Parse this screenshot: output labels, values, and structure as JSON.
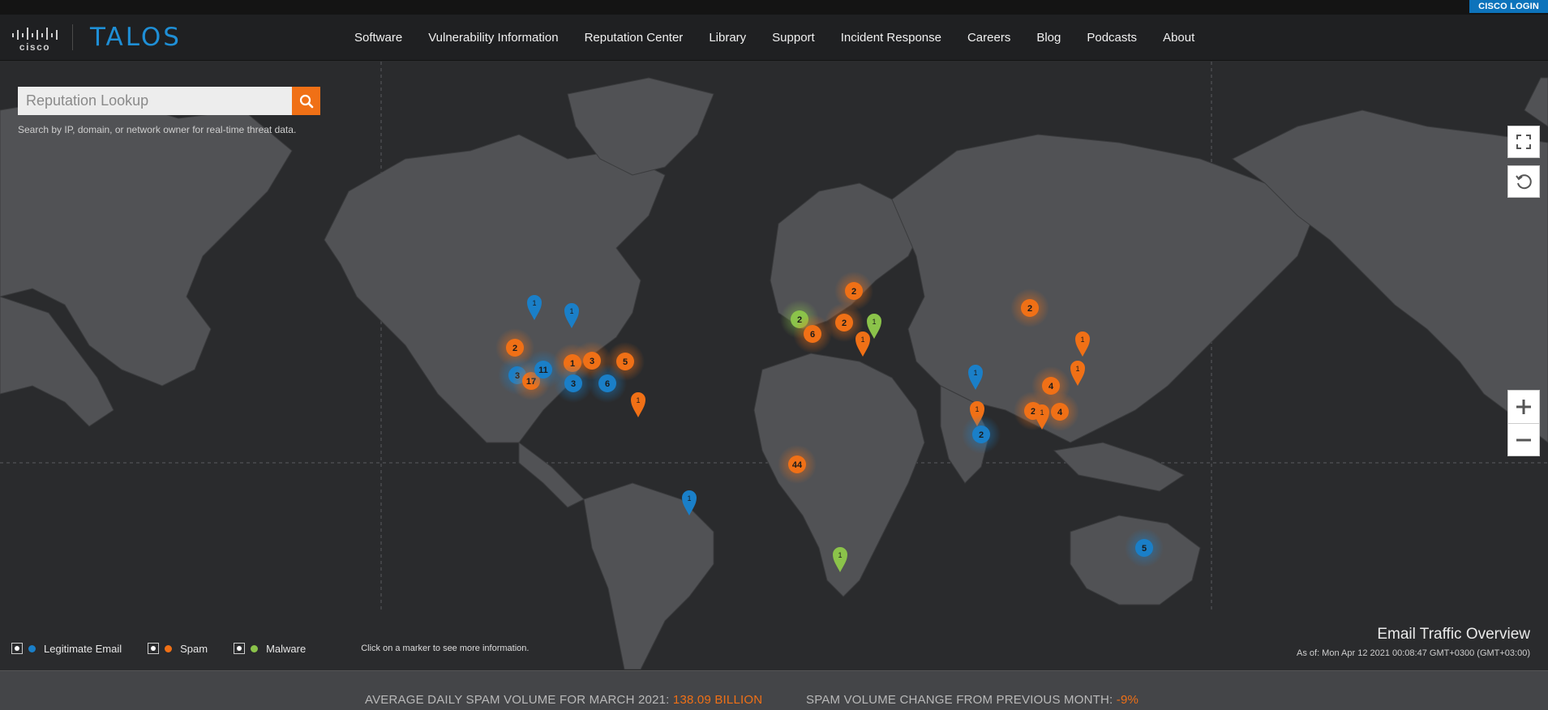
{
  "header": {
    "cisco_login": "CISCO LOGIN",
    "logo_cisco": "cisco",
    "logo_talos": "TALOS",
    "nav": [
      "Software",
      "Vulnerability Information",
      "Reputation Center",
      "Library",
      "Support",
      "Incident Response",
      "Careers",
      "Blog",
      "Podcasts",
      "About"
    ]
  },
  "search": {
    "placeholder": "Reputation Lookup",
    "help": "Search by IP, domain, or network owner for real-time threat data."
  },
  "legend": {
    "items": [
      {
        "label": "Legitimate Email",
        "color": "#1a7fc8"
      },
      {
        "label": "Spam",
        "color": "#f07016"
      },
      {
        "label": "Malware",
        "color": "#8bc34a"
      }
    ],
    "hint": "Click on a marker to see more information."
  },
  "overview": {
    "title": "Email Traffic Overview",
    "as_of": "As of: Mon Apr 12 2021 00:08:47 GMT+0300 (GMT+03:00)"
  },
  "stats": {
    "spam_volume_label": "AVERAGE DAILY SPAM VOLUME FOR MARCH 2021:",
    "spam_volume_value": "138.09 BILLION",
    "change_label": "SPAM VOLUME CHANGE FROM PREVIOUS MONTH:",
    "change_value": "-9%"
  },
  "colors": {
    "legit": "#1a7fc8",
    "spam": "#f07016",
    "malware": "#8bc34a"
  },
  "markers": [
    {
      "label": "1",
      "type": "legit",
      "kind": "pin"
    },
    {
      "label": "1",
      "type": "legit",
      "kind": "pin"
    },
    {
      "label": "2",
      "type": "spam",
      "kind": "cluster"
    },
    {
      "label": "3",
      "type": "legit",
      "kind": "cluster"
    },
    {
      "label": "17",
      "type": "spam",
      "kind": "cluster"
    },
    {
      "label": "11",
      "type": "legit",
      "kind": "cluster"
    },
    {
      "label": "1",
      "type": "spam",
      "kind": "cluster"
    },
    {
      "label": "3",
      "type": "spam",
      "kind": "cluster"
    },
    {
      "label": "5",
      "type": "spam",
      "kind": "cluster"
    },
    {
      "label": "3",
      "type": "legit",
      "kind": "cluster"
    },
    {
      "label": "6",
      "type": "legit",
      "kind": "cluster"
    },
    {
      "label": "1",
      "type": "spam",
      "kind": "pin"
    },
    {
      "label": "2",
      "type": "malware",
      "kind": "cluster"
    },
    {
      "label": "6",
      "type": "spam",
      "kind": "cluster"
    },
    {
      "label": "2",
      "type": "spam",
      "kind": "cluster"
    },
    {
      "label": "2",
      "type": "spam",
      "kind": "cluster"
    },
    {
      "label": "1",
      "type": "malware",
      "kind": "pin"
    },
    {
      "label": "1",
      "type": "spam",
      "kind": "pin"
    },
    {
      "label": "44",
      "type": "spam",
      "kind": "cluster"
    },
    {
      "label": "1",
      "type": "malware",
      "kind": "pin"
    },
    {
      "label": "1",
      "type": "legit",
      "kind": "pin"
    },
    {
      "label": "2",
      "type": "spam",
      "kind": "cluster"
    },
    {
      "label": "1",
      "type": "spam",
      "kind": "pin"
    },
    {
      "label": "1",
      "type": "spam",
      "kind": "pin"
    },
    {
      "label": "1",
      "type": "legit",
      "kind": "pin"
    },
    {
      "label": "4",
      "type": "spam",
      "kind": "cluster"
    },
    {
      "label": "2",
      "type": "spam",
      "kind": "cluster"
    },
    {
      "label": "4",
      "type": "spam",
      "kind": "cluster"
    },
    {
      "label": "1",
      "type": "spam",
      "kind": "pin"
    },
    {
      "label": "1",
      "type": "spam",
      "kind": "pin"
    },
    {
      "label": "2",
      "type": "legit",
      "kind": "cluster"
    },
    {
      "label": "5",
      "type": "legit",
      "kind": "cluster"
    }
  ]
}
